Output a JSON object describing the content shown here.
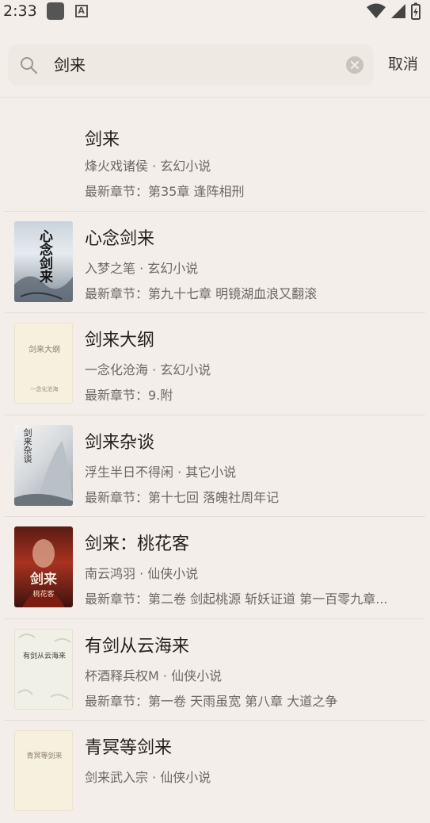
{
  "status_bar": {
    "time": "2:33"
  },
  "search": {
    "query": "剑来",
    "cancel_label": "取消"
  },
  "results": [
    {
      "title": "剑来",
      "author_genre": "烽火戏诸侯 · 玄幻小说",
      "latest": "最新章节：第35章 逢阵相刑",
      "cover": "none"
    },
    {
      "title": "心念剑来",
      "author_genre": "入梦之笔 · 玄幻小说",
      "latest": "最新章节：第九十七章 明镜湖血浪又翻滚",
      "cover_text": "心念剑来"
    },
    {
      "title": "剑来大纲",
      "author_genre": "一念化沧海 · 玄幻小说",
      "latest": "最新章节：9.附",
      "cover_text": "剑来大纲",
      "cover_sub": "一念化沧海"
    },
    {
      "title": "剑来杂谈",
      "author_genre": "浮生半日不得闲 · 其它小说",
      "latest": "最新章节：第十七回 落魄社周年记",
      "cover_text": "剑来杂谈"
    },
    {
      "title": "剑来：桃花客",
      "author_genre": "南云鸿羽 · 仙侠小说",
      "latest": "最新章节：第二卷 剑起桃源 斩妖证道 第一百零九章...",
      "cover_text": "剑来",
      "cover_sub": "桃花客"
    },
    {
      "title": "有剑从云海来",
      "author_genre": "杯酒释兵权M · 仙侠小说",
      "latest": "最新章节：第一卷 天雨虽宽 第八章 大道之争",
      "cover_text": "有剑从云海来"
    },
    {
      "title": "青冥等剑来",
      "author_genre": "剑来武入宗 · 仙侠小说",
      "latest": "",
      "cover_text": "青冥等剑来"
    }
  ],
  "colors": {
    "background": "#f3eee9",
    "search_box": "#efe9e4",
    "text_primary": "#231f1c",
    "text_secondary": "#6e6762"
  },
  "icons": [
    "search-icon",
    "clear-icon",
    "wifi-icon",
    "signal-icon",
    "battery-icon"
  ]
}
